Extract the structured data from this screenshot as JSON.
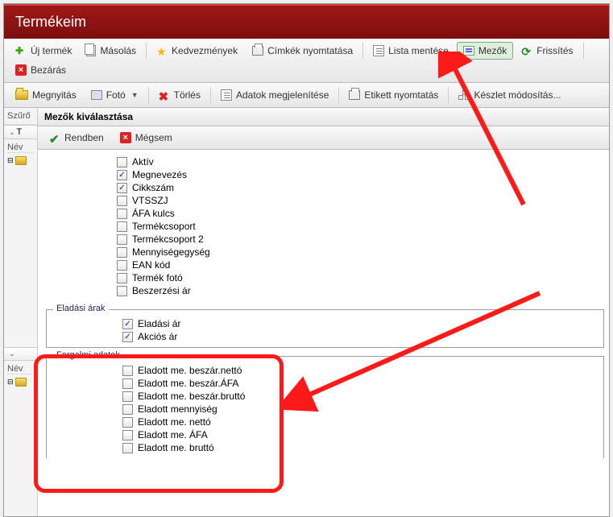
{
  "header": {
    "title": "Termékeim"
  },
  "toolbar1": {
    "new": "Új termék",
    "copy": "Másolás",
    "discount": "Kedvezmények",
    "labels": "Címkék nyomtatása",
    "savelist": "Lista mentése",
    "fields": "Mezők",
    "refresh": "Frissítés",
    "close": "Bezárás"
  },
  "toolbar2": {
    "open": "Megnyitás",
    "photo": "Fotó",
    "delete": "Törlés",
    "showdata": "Adatok megjelenítése",
    "labelprint": "Etikett nyomtatás",
    "stockmod": "Készlet módosítás..."
  },
  "sidebar": {
    "filter": "Szűrő",
    "tab_t": "T",
    "nev": "Név"
  },
  "panel": {
    "title": "Mezők kiválasztása",
    "ok": "Rendben",
    "cancel": "Mégsem"
  },
  "groups": {
    "g1": {
      "items": [
        {
          "label": "Aktív",
          "checked": false
        },
        {
          "label": "Megnevezés",
          "checked": true
        },
        {
          "label": "Cikkszám",
          "checked": true
        },
        {
          "label": "VTSSZJ",
          "checked": false
        },
        {
          "label": "ÁFA kulcs",
          "checked": false
        },
        {
          "label": "Termékcsoport",
          "checked": false
        },
        {
          "label": "Termékcsoport 2",
          "checked": false
        },
        {
          "label": "Mennyiségegység",
          "checked": false
        },
        {
          "label": "EAN kód",
          "checked": false
        },
        {
          "label": "Termék fotó",
          "checked": false
        },
        {
          "label": "Beszerzési ár",
          "checked": false
        }
      ]
    },
    "g2": {
      "legend": "Eladási árak",
      "items": [
        {
          "label": "Eladási ár",
          "checked": true
        },
        {
          "label": "Akciós ár",
          "checked": true
        }
      ]
    },
    "g3": {
      "legend": "Forgalmi adatok",
      "items": [
        {
          "label": "Eladott me. beszár.nettó",
          "checked": false
        },
        {
          "label": "Eladott me. beszár.ÁFA",
          "checked": false
        },
        {
          "label": "Eladott me. beszár.bruttó",
          "checked": false
        },
        {
          "label": "Eladott mennyiség",
          "checked": false
        },
        {
          "label": "Eladott me. nettó",
          "checked": false
        },
        {
          "label": "Eladott me. ÁFA",
          "checked": false
        },
        {
          "label": "Eladott me. bruttó",
          "checked": false
        }
      ]
    }
  }
}
